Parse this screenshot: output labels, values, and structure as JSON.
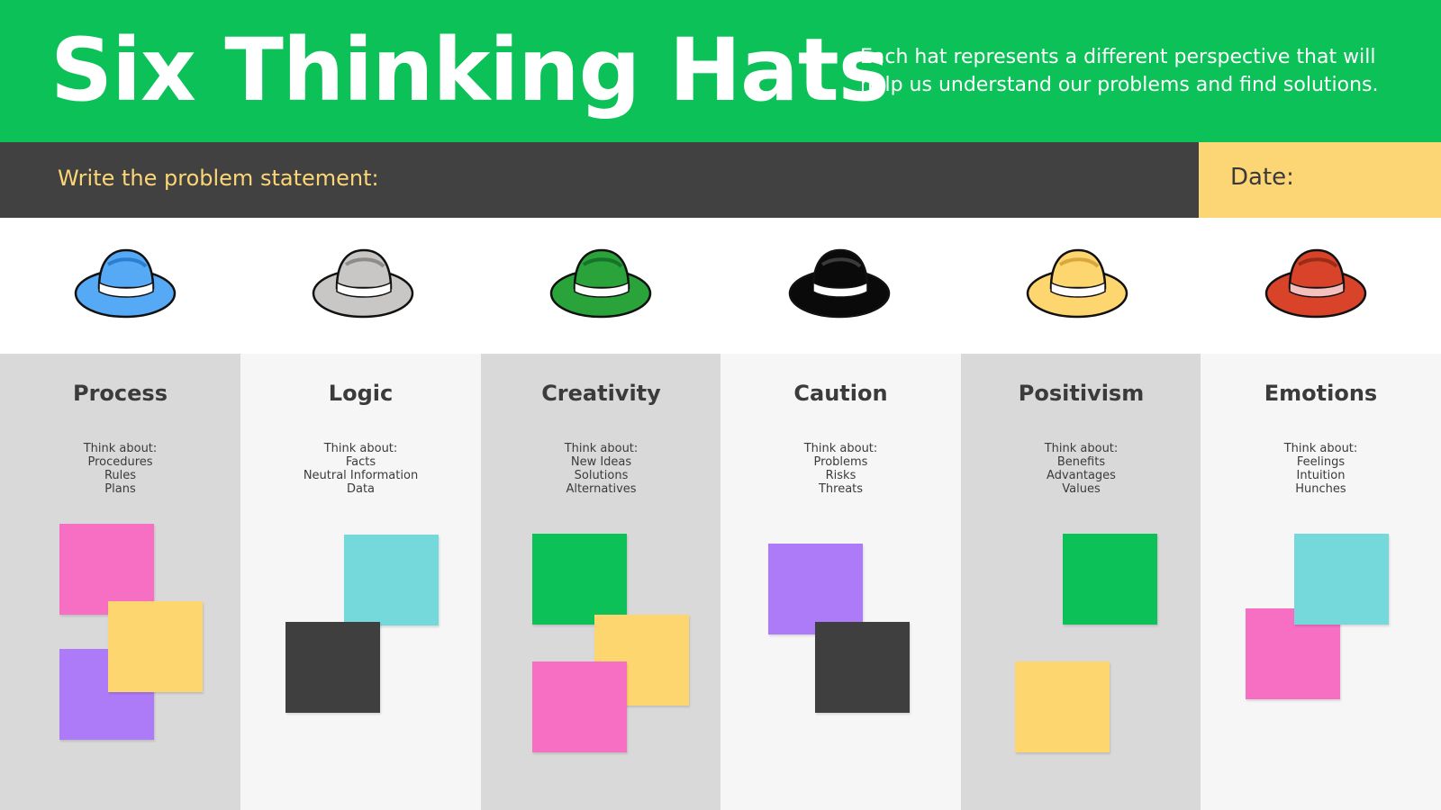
{
  "header": {
    "title": "Six Thinking Hats",
    "subtitle_line1": "Each hat represents a different perspective that will",
    "subtitle_line2": "help us understand our problems and find solutions."
  },
  "problem": {
    "label": "Write the problem statement:"
  },
  "date": {
    "label": "Date:"
  },
  "colors": {
    "header_green": "#0cc157",
    "bar_dark": "#414141",
    "accent_yellow": "#fcd575",
    "column_dark": "#d9d9d9",
    "column_light": "#f6f6f6",
    "note_pink": "#f66fc2",
    "note_yellow": "#fdd670",
    "note_purple": "#ad7bf8",
    "note_teal": "#75d8da",
    "note_dark": "#3f3f3f",
    "note_green": "#0cc157"
  },
  "hats": [
    {
      "icon": "blue-hat-icon",
      "color": "#56aaf5",
      "band": "#ffffff"
    },
    {
      "icon": "white-hat-icon",
      "color": "#c9c7c6",
      "band": "#ffffff"
    },
    {
      "icon": "green-hat-icon",
      "color": "#2aa33b",
      "band": "#ffffff"
    },
    {
      "icon": "black-hat-icon",
      "color": "#0a0a0a",
      "band": "#ffffff"
    },
    {
      "icon": "yellow-hat-icon",
      "color": "#fdd670",
      "band": "#ffffff"
    },
    {
      "icon": "red-hat-icon",
      "color": "#d9432a",
      "band": "#f3c0bd"
    }
  ],
  "columns": [
    {
      "title": "Process",
      "think": "Think about:",
      "items": [
        "Procedures",
        "Rules",
        "Plans"
      ]
    },
    {
      "title": "Logic",
      "think": "Think about:",
      "items": [
        "Facts",
        "Neutral Information",
        "Data"
      ]
    },
    {
      "title": "Creativity",
      "think": "Think about:",
      "items": [
        "New Ideas",
        "Solutions",
        "Alternatives"
      ]
    },
    {
      "title": "Caution",
      "think": "Think about:",
      "items": [
        "Problems",
        "Risks",
        "Threats"
      ]
    },
    {
      "title": "Positivism",
      "think": "Think about:",
      "items": [
        "Benefits",
        "Advantages",
        "Values"
      ]
    },
    {
      "title": "Emotions",
      "think": "Think about:",
      "items": [
        "Feelings",
        "Intuition",
        "Hunches"
      ]
    }
  ]
}
